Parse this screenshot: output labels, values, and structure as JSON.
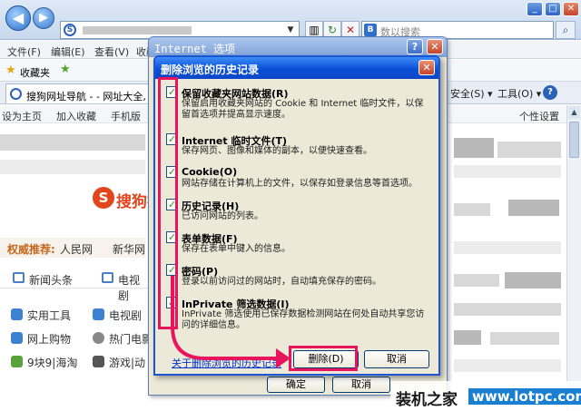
{
  "browser": {
    "search_placeholder": "数以搜索",
    "menu": [
      "文件(F)",
      "编辑(E)",
      "查看(V)",
      "收藏"
    ],
    "favorites_label": "收藏夹",
    "tab_title": "搜狗网址导航 - - 网址大全, 实用",
    "cmd_security": "安全(S) ▾",
    "cmd_tools": "工具(O) ▾"
  },
  "page": {
    "top_links": [
      "设为主页",
      "加入收藏",
      "手机版"
    ],
    "personal_settings": "个性设置",
    "logo_text": "搜狗携",
    "recommend_label": "权威推荐:",
    "recommend_links": [
      "人民网",
      "新华网"
    ],
    "tabs": [
      "新闻头条",
      "电视剧"
    ],
    "list_left": [
      "实用工具",
      "网上购物",
      "9块9|海淘"
    ],
    "list_right": [
      "电视剧",
      "热门电影",
      "游戏|动"
    ]
  },
  "internet_options": {
    "title": "Internet 选项",
    "ok_label": "确定",
    "cancel_label": "取消"
  },
  "delete_history": {
    "title": "删除浏览的历史记录",
    "options": [
      {
        "label": "保留收藏夹网站数据(R)",
        "desc": "保留启用收藏夹网站的 Cookie 和 Internet 临时文件，以保留首选项并提高显示速度。",
        "checked": true
      },
      {
        "label": "Internet 临时文件(T)",
        "desc": "保存网页、图像和媒体的副本，以便快速查看。",
        "checked": true
      },
      {
        "label": "Cookie(O)",
        "desc": "网站存储在计算机上的文件，以保存如登录信息等首选项。",
        "checked": true
      },
      {
        "label": "历史记录(H)",
        "desc": "已访问网站的列表。",
        "checked": true
      },
      {
        "label": "表单数据(F)",
        "desc": "保存在表单中键入的信息。",
        "checked": true
      },
      {
        "label": "密码(P)",
        "desc": "登录以前访问过的网站时，自动填充保存的密码。",
        "checked": true
      },
      {
        "label": "InPrivate 筛选数据(I)",
        "desc": "InPrivate 筛选使用已保存数据检测网站在何处自动共享您访问的详细信息。",
        "checked": true
      }
    ],
    "about_link": "关于删除浏览的历史记录",
    "delete_label": "删除(D)",
    "cancel_label": "取消"
  },
  "watermark": {
    "site_name": "装机之家",
    "url": "www.lotpc.com"
  },
  "colors": {
    "highlight": "#e8155c",
    "title_blue": "#0a4fd6",
    "dialog_bg": "#ece9d8"
  }
}
